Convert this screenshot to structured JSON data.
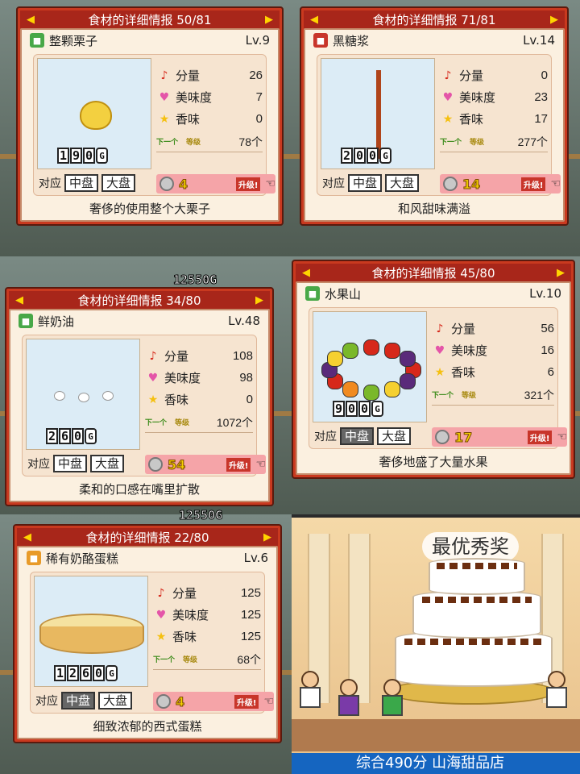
{
  "panels": [
    {
      "header": "食材的详细情报 50/81",
      "name": "整颗栗子",
      "level": "Lv.9",
      "price_digits": [
        "1",
        "9",
        "0"
      ],
      "stats": [
        {
          "label": "分量",
          "value": "26"
        },
        {
          "label": "美味度",
          "value": "7"
        },
        {
          "label": "香味",
          "value": "0"
        }
      ],
      "stock": "78个",
      "cost": "4",
      "plate_label": "对应",
      "plates": [
        "中盘",
        "大盘"
      ],
      "plate_active": [
        false,
        false
      ],
      "description": "奢侈的使用整个大栗子"
    },
    {
      "header": "食材的详细情报 71/81",
      "name": "黑糖浆",
      "level": "Lv.14",
      "price_digits": [
        "2",
        "0",
        "0"
      ],
      "stats": [
        {
          "label": "分量",
          "value": "0"
        },
        {
          "label": "美味度",
          "value": "23"
        },
        {
          "label": "香味",
          "value": "17"
        }
      ],
      "stock": "277个",
      "cost": "14",
      "plate_label": "对应",
      "plates": [
        "中盘",
        "大盘"
      ],
      "plate_active": [
        false,
        false
      ],
      "description": "和风甜味满溢"
    },
    {
      "header": "食材的详细情报 34/80",
      "name": "鲜奶油",
      "level": "Lv.48",
      "price_digits": [
        "2",
        "6",
        "0"
      ],
      "stats": [
        {
          "label": "分量",
          "value": "108"
        },
        {
          "label": "美味度",
          "value": "98"
        },
        {
          "label": "香味",
          "value": "0"
        }
      ],
      "stock": "1072个",
      "cost": "54",
      "plate_label": "对应",
      "plates": [
        "中盘",
        "大盘"
      ],
      "plate_active": [
        false,
        false
      ],
      "description": "柔和的口感在嘴里扩散"
    },
    {
      "header": "食材的详细情报 45/80",
      "name": "水果山",
      "level": "Lv.10",
      "price_digits": [
        "9",
        "0",
        "0"
      ],
      "stats": [
        {
          "label": "分量",
          "value": "56"
        },
        {
          "label": "美味度",
          "value": "16"
        },
        {
          "label": "香味",
          "value": "6"
        }
      ],
      "stock": "321个",
      "cost": "17",
      "plate_label": "对应",
      "plates": [
        "中盘",
        "大盘"
      ],
      "plate_active": [
        true,
        false
      ],
      "description": "奢侈地盛了大量水果"
    },
    {
      "header": "食材的详细情报 22/80",
      "name": "稀有奶酪蛋糕",
      "level": "Lv.6",
      "price_digits": [
        "1",
        "2",
        "6",
        "0"
      ],
      "stats": [
        {
          "label": "分量",
          "value": "125"
        },
        {
          "label": "美味度",
          "value": "125"
        },
        {
          "label": "香味",
          "value": "125"
        }
      ],
      "stock": "68个",
      "cost": "4",
      "plate_label": "对应",
      "plates": [
        "中盘",
        "大盘"
      ],
      "plate_active": [
        true,
        false
      ],
      "description": "细致浓郁的西式蛋糕"
    }
  ],
  "money_display": "12550G",
  "award": {
    "title": "最优秀奖",
    "banner": "综合490分 山海甜品店"
  },
  "colors": {
    "header_red": "#c9391f",
    "card_bg": "#fbf0e0",
    "pink_bar": "#f5a4a8",
    "cost_yellow": "#f7d200"
  },
  "icons": {
    "stat_0": "music-note-icon",
    "stat_1": "heart-icon",
    "stat_2": "star-icon"
  }
}
